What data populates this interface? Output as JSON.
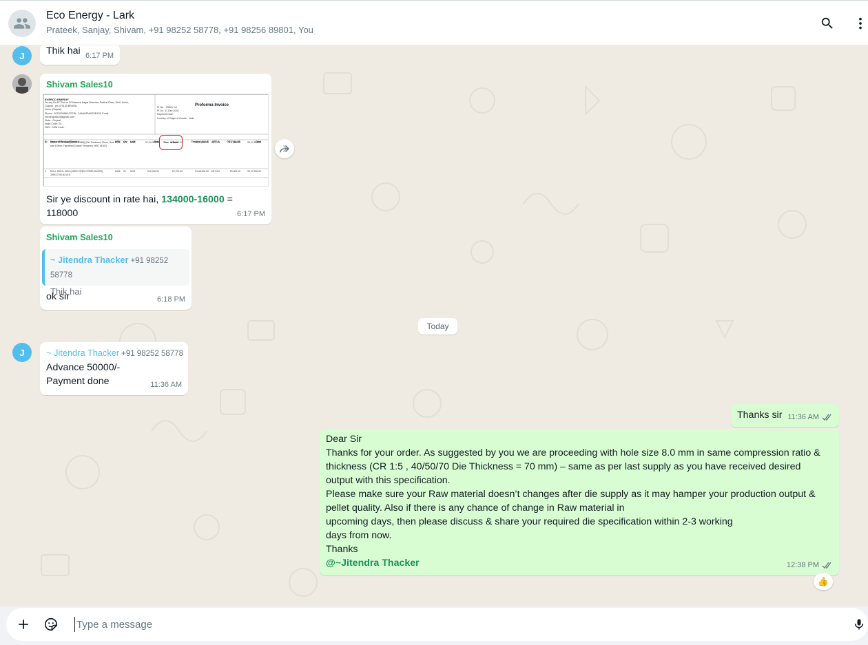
{
  "header": {
    "title": "Eco Energy - Lark",
    "members": "Prateek, Sanjay, Shivam, +91 98252 58778, +91 98256 89801, You",
    "avatar_icon": "group-icon",
    "search_icon": "search-icon",
    "menu_icon": "more-vertical-icon"
  },
  "messages": {
    "m1": {
      "avatar": "J",
      "text": "Thik hai",
      "time": "6:17 PM"
    },
    "m2": {
      "sender": "Shivam Sales10",
      "text_prefix": "Sir ye discount in rate hai, ",
      "highlight": "134000-16000",
      "text_suffix": " = 118000",
      "time": "6:17 PM",
      "invoice": {
        "title": "Proforma Invoice",
        "company": "EVERCO ENERGY",
        "company_lines": [
          "Survey No 87 Plot no 22 Mahavir Nagar Bhachau Dudhai Road, Distt. Kutch,",
          "Gujarat - pin 370140 BRAND,",
          "Kutch (Gujarat)",
          "Phone : 9973000868   GSTIN : 24AAHPN8923B1Z8, Email :",
          "evenergy9834@gmail.com",
          "State : Gujarat",
          "State Code: 24",
          "PAN :    DKM Code :"
        ],
        "right_lines": [
          "PI No. : 25801 1st",
          "PI Dt.: 31 Dec 2025",
          "Payment Date :",
          "Country of Origin of Goods : India"
        ],
        "columns": [
          "Sr",
          "Name of Product/Service",
          "HSN",
          "Qty",
          "UoM",
          "Rate",
          "Disc. in Rate",
          "Taxable VALUE",
          "GST %",
          "GST VALUE",
          "Total"
        ],
        "rows": [
          [
            "1",
            "PELLET DIE MINI (USED 40MM) (Die Thickness 70mm, Hole size 8.0mm, Hardened Double Tempered, HRC 58-62)",
            "8706",
            "2",
            "NOS",
            "₹1,34,000.00",
            "₹16,000.00",
            "₹2,36,000.00",
            "GST 5%",
            "₹11,800.00",
            "₹2,47,800.00"
          ],
          [
            "2",
            "ROLL SHELL MINI (USED OPEN CORRUGATED) 265X170X100-LEG",
            "8436",
            "22",
            "NOS",
            "₹12,000.00",
            "₹2,700.00",
            "₹1,98,000.00",
            "GST 5%",
            "₹9,900.00",
            "₹2,07,900.00"
          ]
        ]
      }
    },
    "m3": {
      "sender": "Shivam Sales10",
      "quote_name": "~ Jitendra Thacker",
      "quote_phone": "+91 98252 58778",
      "quote_text": "Thik hai",
      "text": "ok sir",
      "time": "6:18 PM"
    },
    "date_divider": "Today",
    "m4": {
      "avatar": "J",
      "sender_name": "~ Jitendra Thacker",
      "sender_phone": "+91 98252 58778",
      "line1": "Advance 50000/-",
      "line2": "Payment done",
      "time": "11:36 AM"
    },
    "m5": {
      "text": "Thanks sir",
      "time": "11:36 AM"
    },
    "m6": {
      "lines": [
        "Dear Sir",
        "Thanks for your order. As suggested by you we are proceeding with hole size 8.0 mm in same compression ratio &",
        "thickness (CR 1:5 , 40/50/70 Die Thickness = 70 mm) – same as per last supply as you have received desired",
        "output with this specification.",
        "Please make sure your Raw material doesn’t changes after die supply as it may hamper your production output &",
        "pellet quality. Also if there is any chance of change in Raw material  in",
        "upcoming days, then please discuss & share your required die specification within 2-3 working",
        "days from now.",
        "Thanks"
      ],
      "mention": "@~Jitendra Thacker",
      "time": "12:38 PM",
      "reaction": "👍"
    }
  },
  "composer": {
    "placeholder": "Type a message",
    "attach_icon": "plus-icon",
    "sticker_icon": "sticker-icon",
    "mic_icon": "mic-icon"
  },
  "colors": {
    "chat_bg": "#efeae2",
    "outgoing": "#d9fdd3",
    "incoming": "#ffffff",
    "accent_green": "#1fa855",
    "accent_blue": "#53bdeb"
  }
}
